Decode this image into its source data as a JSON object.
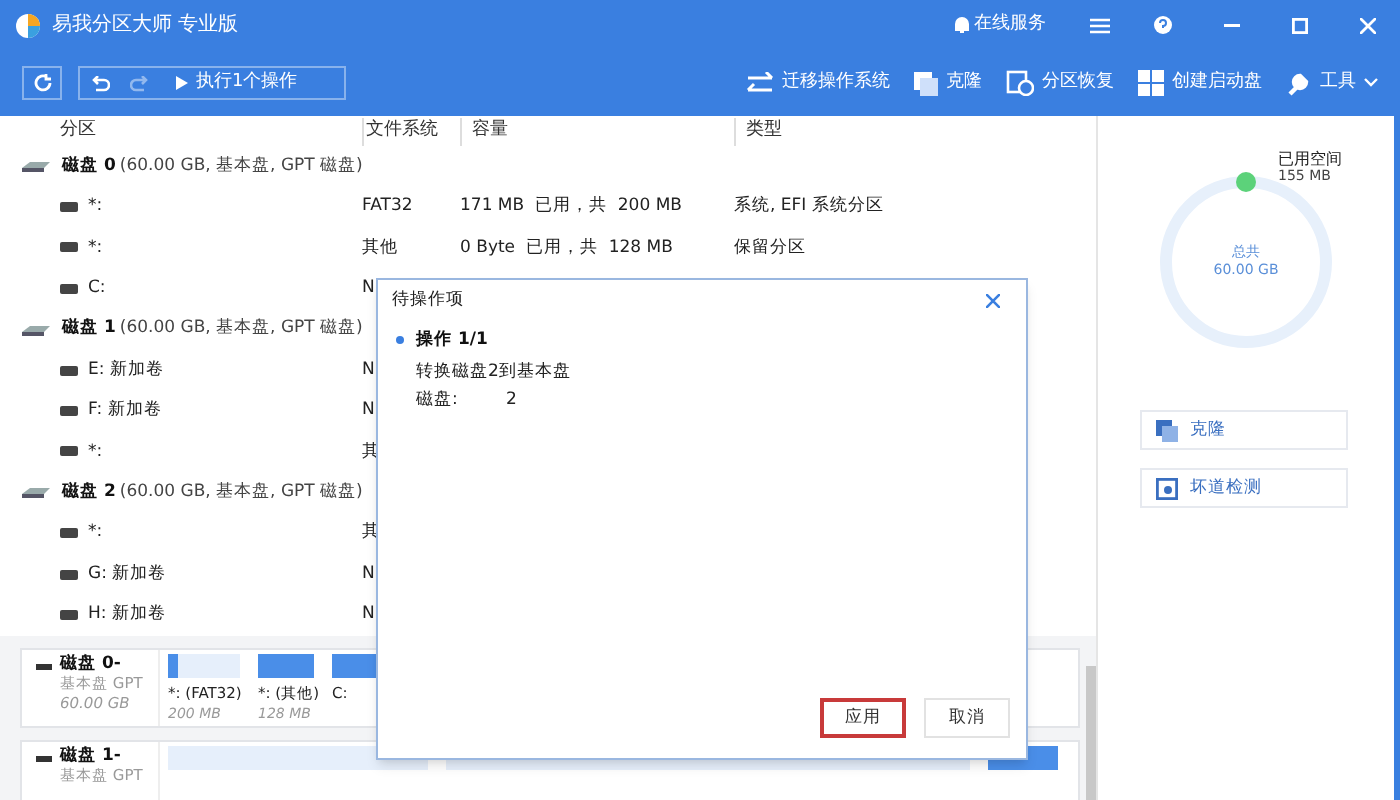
{
  "window": {
    "title": "易我分区大师 专业版",
    "online_service": "在线服务"
  },
  "toolbar": {
    "execute": "执行1个操作",
    "actions": [
      {
        "kind": "migrate",
        "label": "迁移操作系统"
      },
      {
        "kind": "clone",
        "label": "克隆"
      },
      {
        "kind": "recover",
        "label": "分区恢复"
      },
      {
        "kind": "boot",
        "label": "创建启动盘"
      },
      {
        "kind": "tools",
        "label": "工具"
      }
    ]
  },
  "table": {
    "columns": [
      "分区",
      "文件系统",
      "容量",
      "类型"
    ],
    "rows": [
      {
        "kind": "disk",
        "name": "磁盘 0",
        "info": "(60.00 GB, 基本盘, GPT 磁盘)"
      },
      {
        "kind": "part",
        "name": "*:",
        "fs": "FAT32",
        "used": "171 MB",
        "total": "已用，共  200 MB",
        "type": "系统, EFI 系统分区"
      },
      {
        "kind": "part",
        "name": "*:",
        "fs": "其他",
        "used": "0 Byte",
        "total": "已用，共  128 MB",
        "type": "保留分区"
      },
      {
        "kind": "part",
        "name": "C:",
        "fs": "N"
      },
      {
        "kind": "disk",
        "name": "磁盘 1",
        "info": "(60.00 GB, 基本盘, GPT 磁盘)"
      },
      {
        "kind": "part",
        "name": "E: 新加卷",
        "fs": "N"
      },
      {
        "kind": "part",
        "name": "F: 新加卷",
        "fs": "N"
      },
      {
        "kind": "part",
        "name": "*:",
        "fs": "其"
      },
      {
        "kind": "disk",
        "name": "磁盘 2",
        "info": "(60.00 GB, 基本盘, GPT 磁盘)"
      },
      {
        "kind": "part",
        "name": "*:",
        "fs": "其"
      },
      {
        "kind": "part",
        "name": "G: 新加卷",
        "fs": "N"
      },
      {
        "kind": "part",
        "name": "H: 新加卷",
        "fs": "N"
      }
    ]
  },
  "disk_map": [
    {
      "name": "磁盘 0-",
      "sub": "基本盘 GPT",
      "size": "60.00 GB",
      "segments": [
        {
          "label": "*: (FAT32)",
          "size": "200 MB",
          "level": 0.15
        },
        {
          "label": "*: (其他)",
          "size": "128 MB",
          "level": 1
        },
        {
          "label": "C:",
          "level": 1
        }
      ]
    },
    {
      "name": "磁盘 1-",
      "sub": "基本盘 GPT",
      "segments": [
        {
          "level": 0
        },
        {
          "level": 0
        },
        {
          "level": 1
        }
      ]
    }
  ],
  "side": {
    "used_label": "已用空间",
    "used": "155 MB",
    "total_label": "总共",
    "total": "60.00 GB",
    "actions": [
      {
        "kind": "clone",
        "label": "克隆"
      },
      {
        "kind": "check",
        "label": "坏道检测"
      }
    ]
  },
  "dialog": {
    "title": "待操作项",
    "op_title": "操作 1/1",
    "op_desc": "转换磁盘2到基本盘",
    "field_label": "磁盘:",
    "field_value": "2",
    "buttons": [
      {
        "label": "应用",
        "selected": true
      },
      {
        "label": "取消",
        "selected": false
      }
    ]
  }
}
